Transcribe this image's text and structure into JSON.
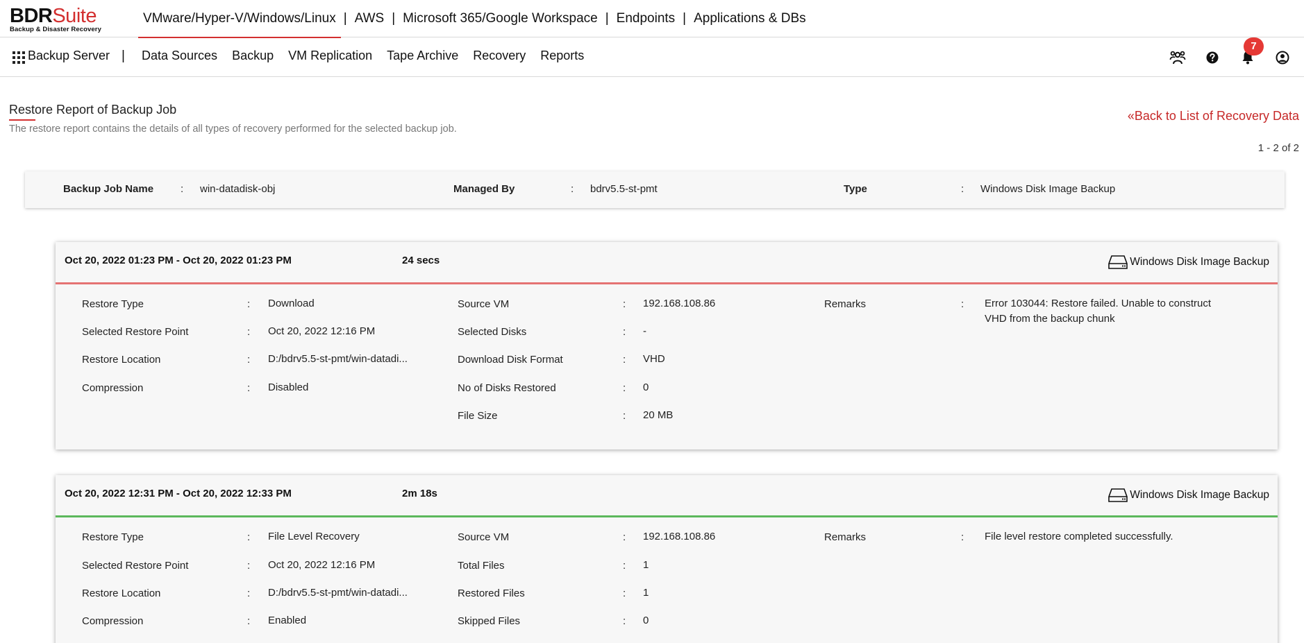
{
  "logo": {
    "brand_a": "BDR",
    "brand_b": "Suite",
    "tagline": "Backup & Disaster Recovery"
  },
  "platform_nav": [
    {
      "label": "VMware/Hyper-V/Windows/Linux",
      "active": true
    },
    {
      "label": "AWS"
    },
    {
      "label": "Microsoft 365/Google Workspace"
    },
    {
      "label": "Endpoints"
    },
    {
      "label": "Applications & DBs"
    }
  ],
  "main_nav": {
    "server_label": "Backup Server",
    "items": [
      "Data Sources",
      "Backup",
      "VM Replication",
      "Tape Archive",
      "Recovery",
      "Reports"
    ]
  },
  "header_icons": {
    "notifications_count": "7",
    "icons": [
      "users-icon",
      "help-icon",
      "bell-icon",
      "user-account-icon"
    ]
  },
  "page": {
    "title": "Restore Report of Backup Job",
    "subtitle": "The restore report contains the details of all types of recovery performed for the selected backup job.",
    "back_link": "«Back to List of Recovery Data",
    "pagination": "1 - 2 of 2"
  },
  "summary": {
    "job_name_label": "Backup Job Name",
    "job_name": "win-datadisk-obj",
    "managed_by_label": "Managed By",
    "managed_by": "bdrv5.5-st-pmt",
    "type_label": "Type",
    "type": "Windows Disk Image Backup"
  },
  "colors": {
    "accent": "#d32f2f",
    "fail": "#e57373",
    "success": "#5cb85c"
  },
  "restores": [
    {
      "period": "Oct 20, 2022 01:23 PM - Oct 20, 2022 01:23 PM",
      "duration": "24 secs",
      "type": "Windows Disk Image Backup",
      "status": "fail",
      "col1": [
        {
          "label": "Restore Type",
          "value": "Download"
        },
        {
          "label": "Selected Restore Point",
          "value": "Oct 20, 2022 12:16 PM"
        },
        {
          "label": "Restore Location",
          "value": "D:/bdrv5.5-st-pmt/win-datadi..."
        },
        {
          "label": "Compression",
          "value": "Disabled"
        }
      ],
      "col2": [
        {
          "label": "Source VM",
          "value": "192.168.108.86"
        },
        {
          "label": "Selected Disks",
          "value": "-"
        },
        {
          "label": "Download Disk Format",
          "value": "VHD"
        },
        {
          "label": "No of Disks Restored",
          "value": "0"
        },
        {
          "label": "File Size",
          "value": "20 MB"
        }
      ],
      "remarks_label": "Remarks",
      "remarks_lines": [
        "Error 103044: Restore failed. Unable to construct",
        "VHD from the backup chunk"
      ]
    },
    {
      "period": "Oct 20, 2022 12:31 PM - Oct 20, 2022 12:33 PM",
      "duration": "2m 18s",
      "type": "Windows Disk Image Backup",
      "status": "ok",
      "col1": [
        {
          "label": "Restore Type",
          "value": "File Level Recovery"
        },
        {
          "label": "Selected Restore Point",
          "value": "Oct 20, 2022 12:16 PM"
        },
        {
          "label": "Restore Location",
          "value": "D:/bdrv5.5-st-pmt/win-datadi..."
        },
        {
          "label": "Compression",
          "value": "Enabled"
        }
      ],
      "col2": [
        {
          "label": "Source VM",
          "value": "192.168.108.86"
        },
        {
          "label": "Total Files",
          "value": "1"
        },
        {
          "label": "Restored Files",
          "value": "1"
        },
        {
          "label": "Skipped Files",
          "value": "0"
        }
      ],
      "remarks_label": "Remarks",
      "remarks_lines": [
        "File level restore completed successfully."
      ]
    }
  ]
}
